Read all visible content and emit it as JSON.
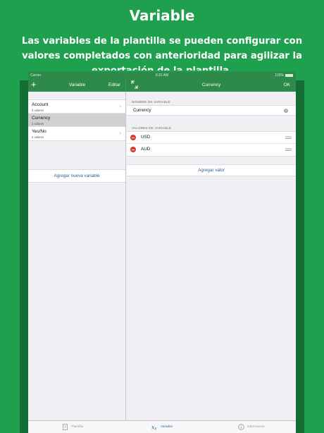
{
  "promo": {
    "title": "Variable",
    "description": "Las variables de la plantilla se pueden configurar con valores completados con anterioridad para agilizar la exportación de la plantilla."
  },
  "status_bar": {
    "carrier": "Carrier",
    "time": "8:31 AM",
    "battery": "100%"
  },
  "nav": {
    "left_title": "Variable",
    "edit_label": "Editar",
    "right_title": "Currency",
    "ok_label": "OK"
  },
  "variables": [
    {
      "name": "Account",
      "count": "2 valores",
      "selected": false
    },
    {
      "name": "Currency",
      "count": "2 valores",
      "selected": true
    },
    {
      "name": "Yes/No",
      "count": "2 valores",
      "selected": false
    }
  ],
  "add_variable_label": "Agregar nueva variable",
  "detail": {
    "name_section": "NOMBRE DE VARIABLE",
    "name_value": "Currency",
    "values_section": "VALORES DE VARIABLE",
    "values": [
      "USD",
      "AUD"
    ],
    "add_value_label": "Agregar valor"
  },
  "tabs": [
    {
      "label": "Plantilla",
      "icon": "document-icon",
      "active": false
    },
    {
      "label": "Variable",
      "icon": "variable-icon",
      "active": true
    },
    {
      "label": "Información",
      "icon": "info-icon",
      "active": false
    }
  ],
  "colors": {
    "background": "#1fa04e",
    "navbar": "#2d8a4a",
    "link": "#2f5e8f",
    "delete": "#e0362c",
    "tab_active": "#2d6fb0"
  }
}
